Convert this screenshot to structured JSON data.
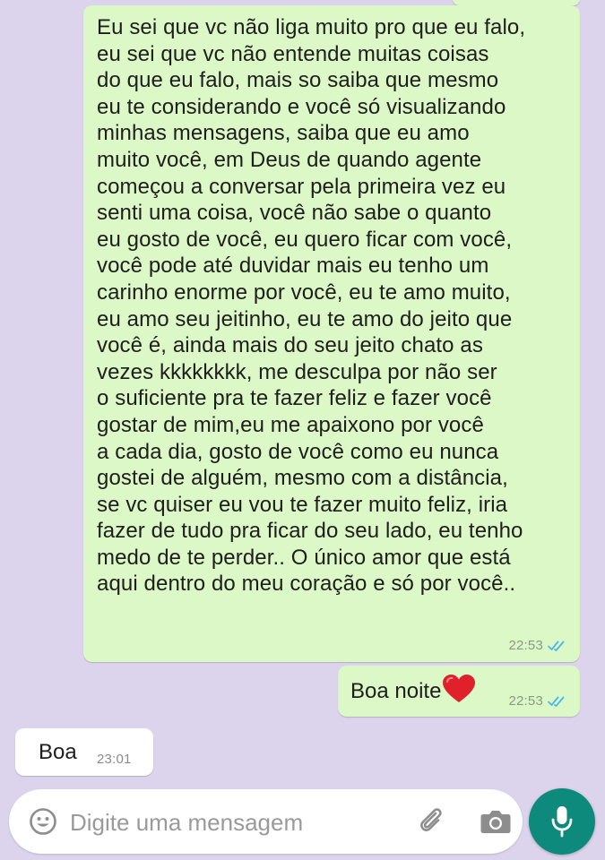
{
  "messages": [
    {
      "direction": "outgoing",
      "text": "Eu sei que vc não liga muito pro que eu falo,\neu sei que vc não entende muitas coisas\ndo que eu falo, mais so saiba que mesmo\neu te considerando e você só visualizando\nminhas mensagens, saiba que eu amo\nmuito você, em Deus de quando agente\ncomeçou a conversar pela primeira vez eu\nsenti uma coisa, você não sabe o quanto\neu gosto de você, eu quero ficar com você,\nvocê pode até duvidar mais eu tenho um\ncarinho enorme por você, eu te amo muito,\neu amo seu jeitinho, eu te amo do jeito que\nvocê é, ainda mais do seu jeito chato as\nvezes kkkkkkkk, me desculpa por não ser\no suficiente pra te fazer feliz e fazer você\ngostar de mim,eu me apaixono por você\na cada dia, gosto de você como eu nunca\ngostei de alguém, mesmo com a distância,\nse vc quiser eu vou te fazer muito feliz, iria\nfazer de tudo pra ficar do seu lado, eu tenho\nmedo de te perder.. O único amor que está\naqui dentro do meu coração e só por você..",
      "time": "22:53",
      "status": "read"
    },
    {
      "direction": "outgoing",
      "text": "Boa noite",
      "emoji": "red-heart",
      "time": "22:53",
      "status": "read"
    },
    {
      "direction": "incoming",
      "text": "Boa",
      "time": "23:01"
    }
  ],
  "input": {
    "placeholder": "Digite uma mensagem",
    "value": ""
  },
  "icons": {
    "emoji": "emoji-icon",
    "attach": "paperclip-icon",
    "camera": "camera-icon",
    "mic": "microphone-icon",
    "read_ticks": "double-check-icon"
  },
  "colors": {
    "background": "#dcd4ec",
    "outgoing_bubble": "#dcf8c6",
    "incoming_bubble": "#ffffff",
    "read_ticks": "#4fb6ec",
    "mic_button": "#0e8a7c",
    "heart": "#e0212b"
  }
}
